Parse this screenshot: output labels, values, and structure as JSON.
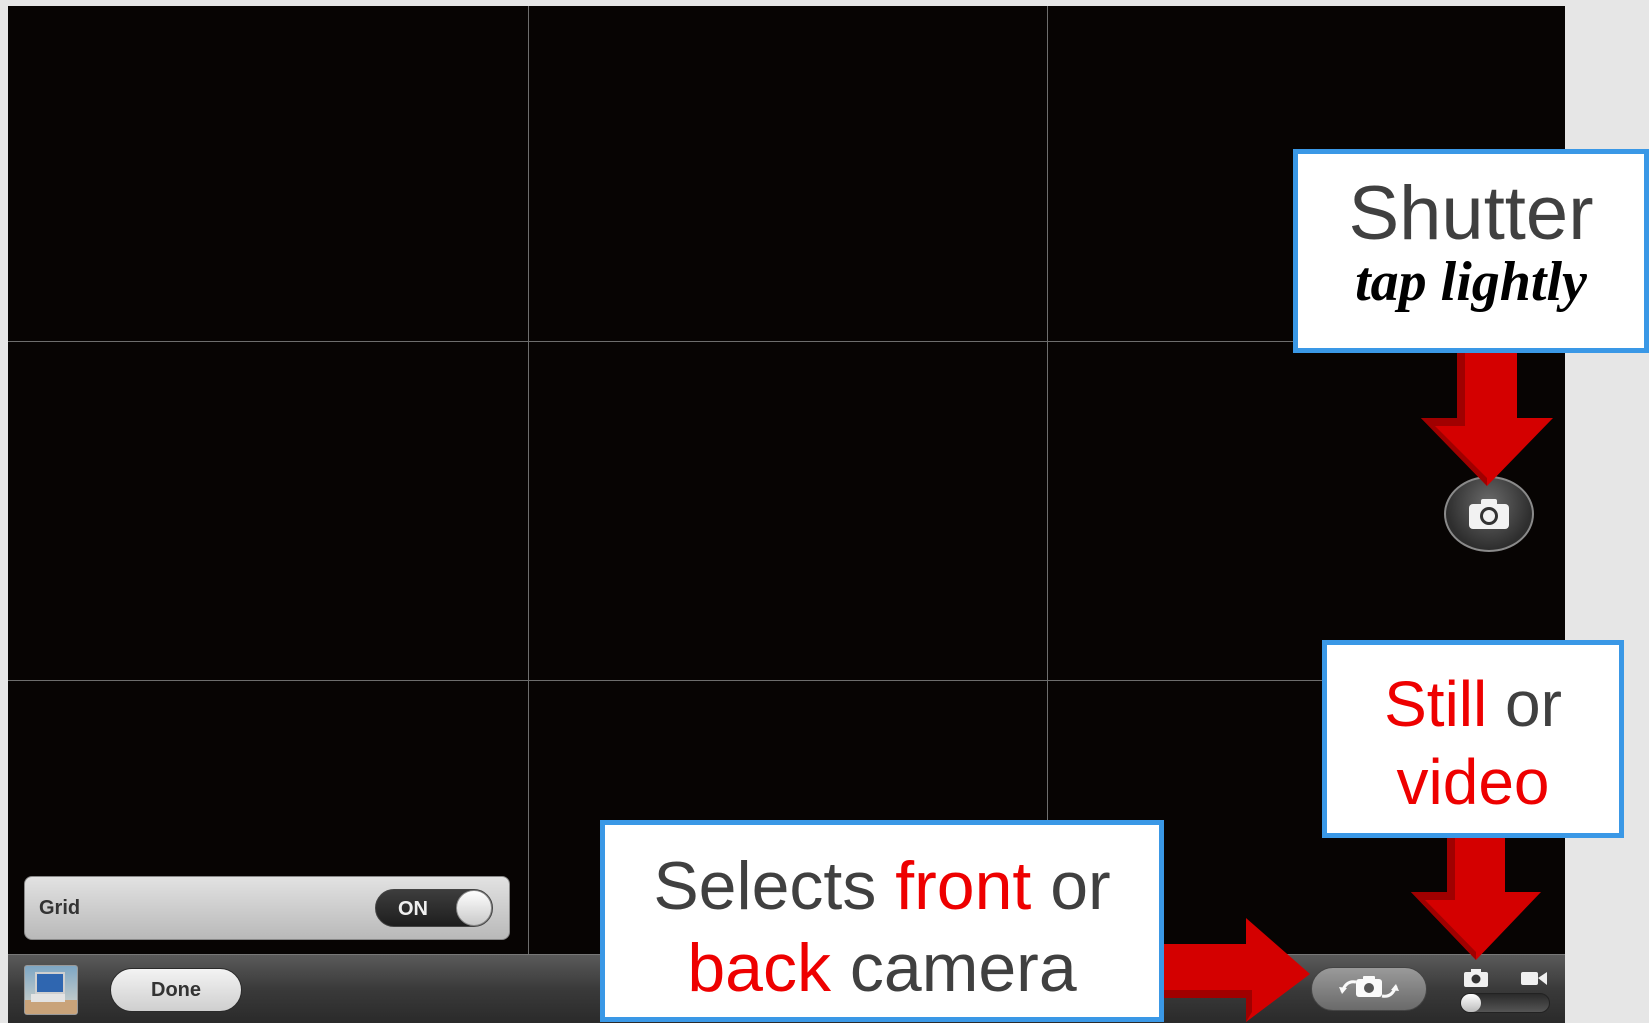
{
  "grid_panel": {
    "label": "Grid",
    "toggle_text": "ON"
  },
  "toolbar": {
    "done_label": "Done"
  },
  "callouts": {
    "shutter": {
      "title": "Shutter",
      "subtitle": "tap lightly"
    },
    "mode": {
      "part1": "Still",
      "part2": " or",
      "part3": "video"
    },
    "camera": {
      "part1": "Selects ",
      "part2": "front",
      "part3": " or",
      "part4": "back",
      "part5": " camera"
    }
  },
  "colors": {
    "callout_border": "#3a98e6",
    "accent_red": "#ee0000",
    "arrow_red": "#d40000"
  },
  "icons": {
    "shutter": "camera-icon",
    "flip": "switch-camera-icon",
    "mode_photo": "camera-icon",
    "mode_video": "video-icon",
    "thumbnail": "photo-thumbnail"
  }
}
